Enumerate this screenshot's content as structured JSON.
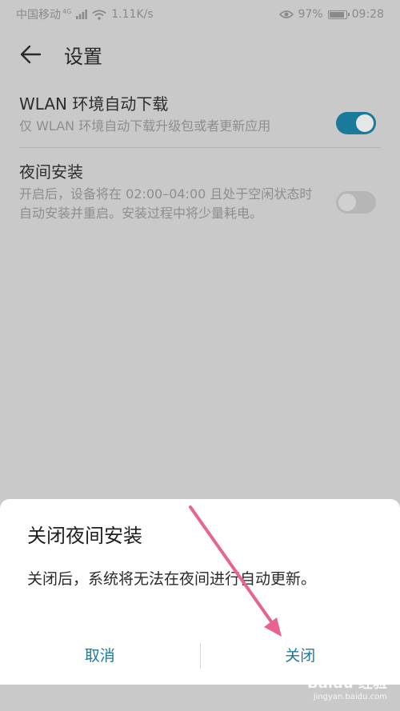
{
  "status_bar": {
    "carrier": "中国移动",
    "network": "4G",
    "speed": "1.11K/s",
    "battery": "97%",
    "time": "09:28",
    "icons": [
      "signal-icon",
      "wifi-icon",
      "eye-icon",
      "battery-icon"
    ]
  },
  "appbar": {
    "title": "设置",
    "back_icon": "back-arrow-icon"
  },
  "settings": [
    {
      "title": "WLAN 环境自动下载",
      "description": "仅 WLAN 环境自动下载升级包或者更新应用",
      "toggle": "on"
    },
    {
      "title": "夜间安装",
      "description": "开启后，设备将在 02:00–04:00 且处于空闲状态时自动安装并重启。安装过程中将少量耗电。",
      "toggle": "off"
    }
  ],
  "dialog": {
    "title": "关闭夜间安装",
    "message": "关闭后，系统将无法在夜间进行自动更新。",
    "cancel_label": "取消",
    "confirm_label": "关闭"
  },
  "watermark": {
    "brand": "Baidu 经验",
    "url": "jingyan.baidu.com"
  },
  "colors": {
    "accent": "#1c7a9b",
    "toggle_on": "#1a7a9a",
    "annotation_arrow": "#e8648f",
    "overlay_bg": "#c9c9c9"
  }
}
